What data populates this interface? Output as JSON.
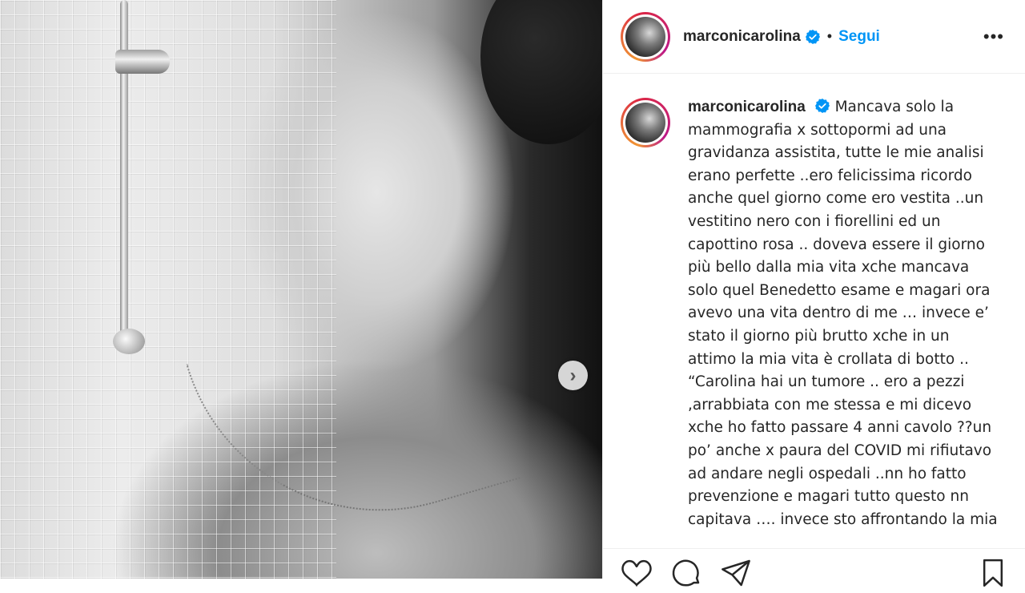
{
  "post": {
    "username": "marconicarolina",
    "verified": true,
    "separator": "•",
    "follow_label": "Segui",
    "more_label": "•••",
    "next_arrow": "›",
    "caption": "Mancava solo la mammografia x sottopormi ad una gravidanza assistita, tutte le mie analisi erano perfette ..ero felicissima ricordo anche quel giorno come ero vestita ..un vestitino nero con i fiorellini ed un capottino rosa .. doveva essere il giorno più bello dalla mia vita xche mancava solo quel Benedetto esame e magari ora avevo una vita dentro di me … invece e’ stato il giorno più brutto xche in un attimo la mia vita è crollata di botto .. “Carolina hai un tumore .. ero a pezzi ,arrabbiata con me stessa e mi dicevo xche ho fatto passare 4 anni cavolo ??un po’ anche x paura del COVID mi rifiutavo ad andare negli ospedali ..nn ho fatto prevenzione e magari tutto questo nn capitava …. invece sto affrontando la mia"
  },
  "icons": {
    "verified": "verified-badge-icon",
    "like": "heart-icon",
    "comment": "comment-bubble-icon",
    "share": "paper-plane-icon",
    "save": "bookmark-icon",
    "next": "chevron-right-icon"
  },
  "colors": {
    "accent": "#0095f6",
    "text": "#262626",
    "border": "#efefef"
  }
}
